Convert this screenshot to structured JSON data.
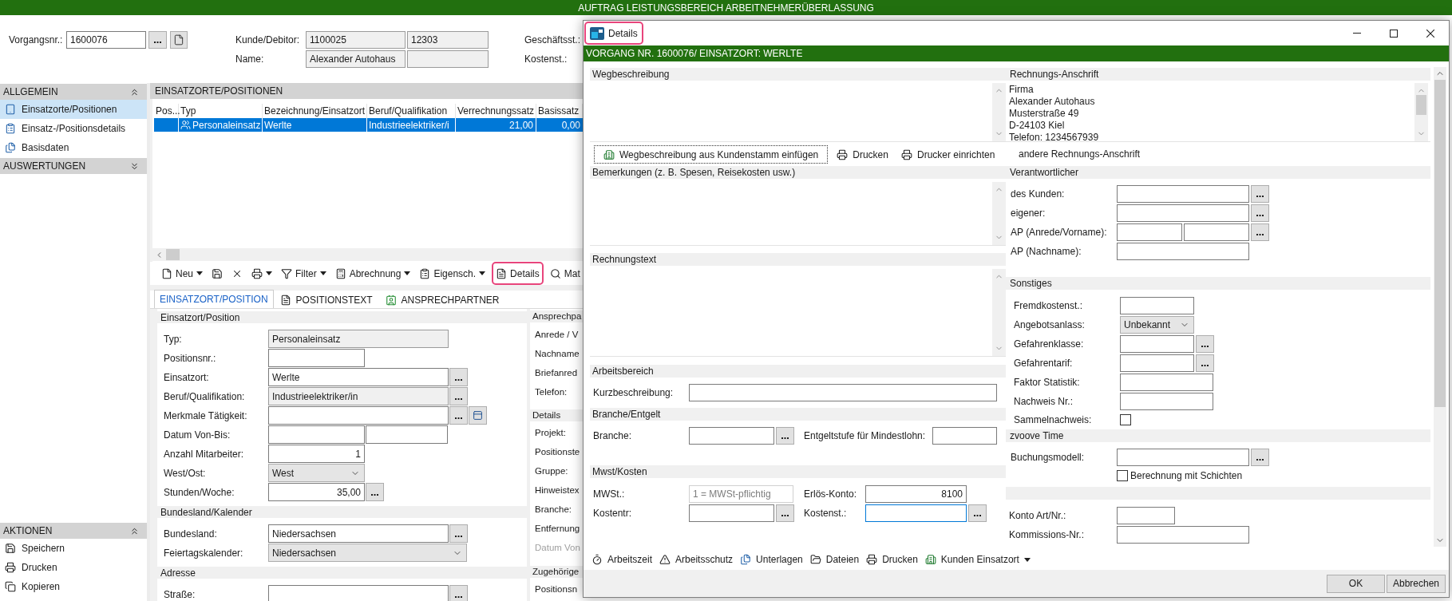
{
  "app_title": "AUFTRAG LEISTUNGSBEREICH ARBEITNEHMERÜBERLASSUNG",
  "header": {
    "vorgang": {
      "label": "Vorgangsnr.:",
      "value": "1600076"
    },
    "kunde": {
      "label": "Kunde/Debitor:",
      "values": [
        "1100025",
        "12303"
      ]
    },
    "name": {
      "label": "Name:",
      "values": [
        "Alexander Autohaus"
      ]
    },
    "geschaeftsstelle": {
      "label": "Geschäftsst.:"
    },
    "kostenstelle": {
      "label": "Kostenst.:"
    }
  },
  "sidebar": {
    "groups": [
      {
        "title": "ALLGEMEIN",
        "expanded": true,
        "items": [
          {
            "label": "Einsatzorte/Positionen",
            "selected": true
          },
          {
            "label": "Einsatz-/Positionsdetails",
            "selected": false
          },
          {
            "label": "Basisdaten",
            "selected": false
          }
        ]
      },
      {
        "title": "AUSWERTUNGEN",
        "expanded": false
      }
    ],
    "actions": {
      "title": "AKTIONEN",
      "expanded": true,
      "items": [
        "Speichern",
        "Drucken",
        "Kopieren"
      ]
    }
  },
  "positions": {
    "title": "EINSATZORTE/POSITIONEN",
    "columns": [
      "Pos...",
      "Typ",
      "Bezeichnung/Einsatzort",
      "Beruf/Qualifikation",
      "Verrechnungssatz",
      "Basissatz"
    ],
    "rows": [
      {
        "selected": true,
        "typ": "Personaleinsatz",
        "bezeichnung": "Werlte",
        "beruf": "Industrieelektriker/i",
        "verrechnungssatz": "21,00",
        "basissatz": "0,00"
      }
    ]
  },
  "toolbar": [
    {
      "label": "Neu",
      "menu": true,
      "highlighted": false
    },
    {
      "menu": false,
      "highlighted": false
    },
    {
      "menu": false,
      "highlighted": false
    },
    {
      "menu": true,
      "highlighted": false
    },
    {
      "label": "Filter",
      "menu": true,
      "highlighted": false
    },
    {
      "label": "Abrechnung",
      "menu": true,
      "highlighted": false
    },
    {
      "label": "Eigensch.",
      "menu": true,
      "highlighted": false
    },
    {
      "label": "Details",
      "menu": false,
      "highlighted": true
    },
    {
      "label": "Mat",
      "menu": false,
      "highlighted": false
    }
  ],
  "tabs": [
    {
      "label": "EINSATZORT/POSITION",
      "selected": true
    },
    {
      "label": "POSITIONSTEXT",
      "selected": false
    },
    {
      "label": "ANSPRECHPARTNER",
      "selected": false
    }
  ],
  "form": {
    "sections": [
      {
        "title": "Einsatzort/Position",
        "rows": [
          {
            "label": "Typ:",
            "fields": [
              {
                "kind": "readonly",
                "value": "Personaleinsatz"
              }
            ]
          },
          {
            "label": "Positionsnr.:",
            "fields": [
              {
                "kind": "text"
              }
            ]
          },
          {
            "label": "Einsatzort:",
            "fields": [
              {
                "kind": "text",
                "value": "Werlte"
              },
              {
                "kind": "lookup"
              }
            ]
          },
          {
            "label": "Beruf/Qualifikation:",
            "fields": [
              {
                "kind": "readonly",
                "value": "Industrieelektriker/in"
              },
              {
                "kind": "lookup"
              }
            ]
          },
          {
            "label": "Merkmale Tätigkeit:",
            "fields": [
              {
                "kind": "text"
              },
              {
                "kind": "lookup"
              },
              {
                "kind": "icon_button"
              }
            ]
          },
          {
            "label": "Datum Von-Bis:",
            "fields": [
              {
                "kind": "text"
              },
              {
                "kind": "text"
              }
            ]
          },
          {
            "label": "Anzahl Mitarbeiter:",
            "fields": [
              {
                "kind": "number",
                "value": "1"
              }
            ]
          },
          {
            "label": "West/Ost:",
            "fields": [
              {
                "kind": "dropdown",
                "value": "West"
              }
            ]
          },
          {
            "label": "Stunden/Woche:",
            "fields": [
              {
                "kind": "number",
                "value": "35,00"
              },
              {
                "kind": "lookup"
              }
            ]
          }
        ]
      },
      {
        "title": "Bundesland/Kalender",
        "rows": [
          {
            "label": "Bundesland:",
            "fields": [
              {
                "kind": "text",
                "value": "Niedersachsen"
              },
              {
                "kind": "lookup"
              }
            ]
          },
          {
            "label": "Feiertagskalender:",
            "fields": [
              {
                "kind": "dropdown",
                "value": "Niedersachsen"
              }
            ]
          }
        ]
      },
      {
        "title": "Adresse",
        "rows": [
          {
            "label": "Straße:",
            "fields": [
              {
                "kind": "text"
              },
              {
                "kind": "lookup"
              }
            ]
          }
        ]
      }
    ]
  },
  "side_form": {
    "sections": [
      {
        "title": "Ansprechpa",
        "rows": [
          {
            "label": "Anrede / V",
            "disabled": false
          },
          {
            "label": "Nachname",
            "disabled": false
          },
          {
            "label": "Briefanred",
            "disabled": false
          },
          {
            "label": "Telefon:",
            "disabled": false
          }
        ]
      },
      {
        "title": "Details",
        "rows": [
          {
            "label": "Projekt:",
            "disabled": false
          },
          {
            "label": "Positionste",
            "disabled": false
          },
          {
            "label": "Gruppe:",
            "disabled": false
          },
          {
            "label": "Hinweistex",
            "disabled": false
          },
          {
            "label": "Branche:",
            "disabled": false
          },
          {
            "label": "Entfernung",
            "disabled": false
          },
          {
            "label": "Datum Von",
            "disabled": true
          }
        ]
      },
      {
        "title": "Zugehörige",
        "rows": [
          {
            "label": "Positionsn",
            "disabled": false
          }
        ]
      }
    ]
  },
  "dialog": {
    "title": "Details",
    "title_highlighted": true,
    "banner": "VORGANG NR. 1600076/ EINSATZORT: WERLTE",
    "left": [
      {
        "kind": "textarea",
        "title": "Wegbeschreibung",
        "actions": [
          {
            "label": "Wegbeschreibung aus Kundenstamm einfügen",
            "focused": true
          },
          {
            "label": "Drucken",
            "focused": false
          },
          {
            "label": "Drucker einrichten",
            "focused": false
          }
        ]
      },
      {
        "kind": "textarea",
        "title": "Bemerkungen (z. B. Spesen, Reisekosten usw.)"
      },
      {
        "kind": "textarea",
        "title": "Rechnungstext"
      },
      {
        "kind": "form",
        "title": "Arbeitsbereich",
        "rows": [
          {
            "items": [
              {
                "label": "Kurzbeschreibung:",
                "fields": [
                  {
                    "kind": "text"
                  }
                ]
              }
            ]
          }
        ]
      },
      {
        "kind": "form",
        "title": "Branche/Entgelt",
        "rows": [
          {
            "items": [
              {
                "label": "Branche:",
                "fields": [
                  {
                    "kind": "text"
                  },
                  {
                    "kind": "lookup"
                  }
                ]
              },
              {
                "label": "Entgeltstufe für Mindestlohn:",
                "fields": [
                  {
                    "kind": "text"
                  }
                ]
              }
            ]
          }
        ]
      },
      {
        "kind": "form",
        "title": "Mwst/Kosten",
        "rows": [
          {
            "items": [
              {
                "label": "MWSt.:",
                "fields": [
                  {
                    "kind": "disabled",
                    "value": "1 = MWSt-pflichtig"
                  }
                ]
              },
              {
                "label": "Erlös-Konto:",
                "fields": [
                  {
                    "kind": "number",
                    "value": "8100"
                  }
                ]
              }
            ]
          },
          {
            "items": [
              {
                "label": "Kostentr:",
                "fields": [
                  {
                    "kind": "text"
                  },
                  {
                    "kind": "lookup"
                  }
                ]
              },
              {
                "label": "Kostenst.:",
                "fields": [
                  {
                    "kind": "focused"
                  },
                  {
                    "kind": "lookup"
                  }
                ]
              }
            ]
          }
        ]
      }
    ],
    "right": [
      {
        "kind": "address",
        "title": "Rechnungs-Anschrift",
        "lines": [
          "Firma",
          "Alexander Autohaus",
          "Musterstraße 49",
          "D-24103 Kiel",
          "Telefon: 1234567939"
        ],
        "link": "andere Rechnungs-Anschrift"
      },
      {
        "kind": "form",
        "title": "Verantwortlicher",
        "rows": [
          {
            "label": "des Kunden:",
            "fields": [
              {
                "kind": "text"
              },
              {
                "kind": "lookup"
              }
            ]
          },
          {
            "label": "eigener:",
            "fields": [
              {
                "kind": "text"
              },
              {
                "kind": "lookup"
              }
            ]
          },
          {
            "label": "AP (Anrede/Vorname):",
            "fields": [
              {
                "kind": "text"
              },
              {
                "kind": "text"
              },
              {
                "kind": "lookup"
              }
            ]
          },
          {
            "label": "AP (Nachname):",
            "fields": [
              {
                "kind": "text"
              }
            ]
          }
        ]
      },
      {
        "kind": "form",
        "title": "Sonstiges",
        "rows": [
          {
            "label": "Fremdkostenst.:",
            "fields": [
              {
                "kind": "text"
              }
            ]
          },
          {
            "label": "Angebotsanlass:",
            "fields": [
              {
                "kind": "dropdown",
                "value": "Unbekannt"
              }
            ]
          },
          {
            "label": "Gefahrenklasse:",
            "fields": [
              {
                "kind": "text"
              },
              {
                "kind": "lookup"
              }
            ]
          },
          {
            "label": "Gefahrentarif:",
            "fields": [
              {
                "kind": "text"
              },
              {
                "kind": "lookup"
              }
            ]
          },
          {
            "label": "Faktor Statistik:",
            "fields": [
              {
                "kind": "text"
              }
            ]
          },
          {
            "label": "Nachweis Nr.:",
            "fields": [
              {
                "kind": "text"
              }
            ]
          },
          {
            "label": "Sammelnachweis:",
            "fields": [
              {
                "kind": "checkbox",
                "checked": false
              }
            ]
          }
        ]
      },
      {
        "kind": "form",
        "title": "zvoove Time",
        "rows": [
          {
            "label": "Buchungsmodell:",
            "fields": [
              {
                "kind": "text"
              },
              {
                "kind": "lookup"
              }
            ]
          },
          {
            "fields": [
              {
                "kind": "checkbox",
                "checked": false,
                "label": "Berechnung mit Schichten"
              }
            ]
          }
        ]
      },
      {
        "kind": "form",
        "rows": [
          {
            "label": "Konto Art/Nr.:",
            "fields": [
              {
                "kind": "text"
              }
            ]
          },
          {
            "label": "Kommissions-Nr.:",
            "fields": [
              {
                "kind": "text"
              }
            ]
          }
        ]
      }
    ],
    "toolbar": [
      {
        "label": "Arbeitszeit",
        "menu": false
      },
      {
        "label": "Arbeitsschutz",
        "menu": false
      },
      {
        "label": "Unterlagen",
        "menu": false
      },
      {
        "label": "Dateien",
        "menu": false
      },
      {
        "label": "Drucken",
        "menu": false
      },
      {
        "label": "Kunden Einsatzort",
        "menu": true
      }
    ],
    "buttons": [
      "OK",
      "Abbrechen"
    ]
  }
}
